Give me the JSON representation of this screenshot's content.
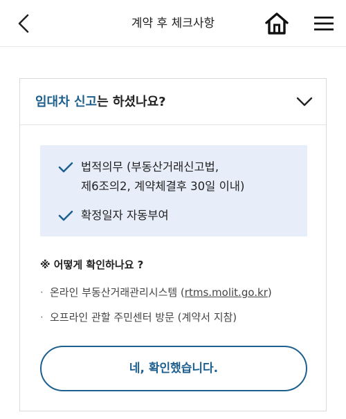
{
  "header": {
    "title": "계약 후 체크사항"
  },
  "card": {
    "question_highlight": "임대차 신고",
    "question_rest": "는 하셨나요?",
    "info_items": [
      {
        "text": "법적의무 (부동산거래신고법,\n제6조의2, 계약체결후 30일 이내)"
      },
      {
        "text": "확정일자 자동부여"
      }
    ],
    "how_title": "※ 어떻게 확인하나요 ?",
    "bullets": [
      {
        "prefix": "온라인 부동산거래관리시스템 (",
        "link": "rtms.molit.go.kr",
        "suffix": ")"
      },
      {
        "text": "오프라인 관할 주민센터 방문 (계약서 지참)"
      }
    ],
    "bullet_mark": "·",
    "confirm_label": "네, 확인했습니다."
  },
  "colors": {
    "accent": "#1d5f8e",
    "info_bg": "#e8eef9",
    "border": "#d9d9d9"
  },
  "icons": [
    "back-arrow-icon",
    "home-icon",
    "hamburger-menu-icon",
    "chevron-down-icon",
    "check-icon"
  ]
}
